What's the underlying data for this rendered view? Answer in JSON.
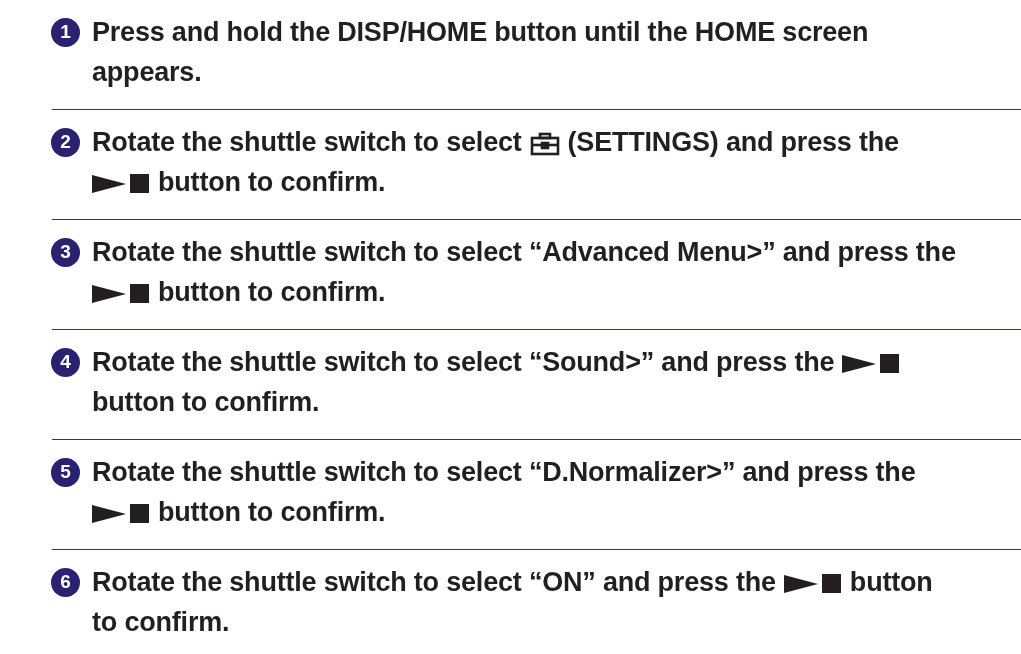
{
  "steps": [
    {
      "number": "1",
      "lines": [
        [
          {
            "kind": "text",
            "text": "Press and hold the DISP/HOME button until the HOME screen"
          }
        ],
        [
          {
            "kind": "text",
            "text": "appears."
          }
        ]
      ]
    },
    {
      "number": "2",
      "lines": [
        [
          {
            "kind": "text",
            "text": "Rotate the shuttle switch to select"
          },
          {
            "kind": "toolbox"
          },
          {
            "kind": "text",
            "text": "(SETTINGS) and press the"
          }
        ],
        [
          {
            "kind": "playstop"
          },
          {
            "kind": "text",
            "text": "button to confirm."
          }
        ]
      ]
    },
    {
      "number": "3",
      "lines": [
        [
          {
            "kind": "text",
            "text": "Rotate the shuttle switch to select “Advanced Menu>” and press the"
          }
        ],
        [
          {
            "kind": "playstop"
          },
          {
            "kind": "text",
            "text": "button to confirm."
          }
        ]
      ]
    },
    {
      "number": "4",
      "lines": [
        [
          {
            "kind": "text",
            "text": "Rotate the shuttle switch to select “Sound>” and press the"
          },
          {
            "kind": "playstop"
          }
        ],
        [
          {
            "kind": "text",
            "text": "button to confirm."
          }
        ]
      ]
    },
    {
      "number": "5",
      "lines": [
        [
          {
            "kind": "text",
            "text": "Rotate the shuttle switch to select “D.Normalizer>” and press the"
          }
        ],
        [
          {
            "kind": "playstop"
          },
          {
            "kind": "text",
            "text": "button to confirm."
          }
        ]
      ]
    },
    {
      "number": "6",
      "lines": [
        [
          {
            "kind": "text",
            "text": "Rotate the shuttle switch to select “ON” and press the"
          },
          {
            "kind": "playstop"
          },
          {
            "kind": "text",
            "text": "button"
          }
        ],
        [
          {
            "kind": "text",
            "text": "to confirm."
          }
        ]
      ]
    }
  ]
}
